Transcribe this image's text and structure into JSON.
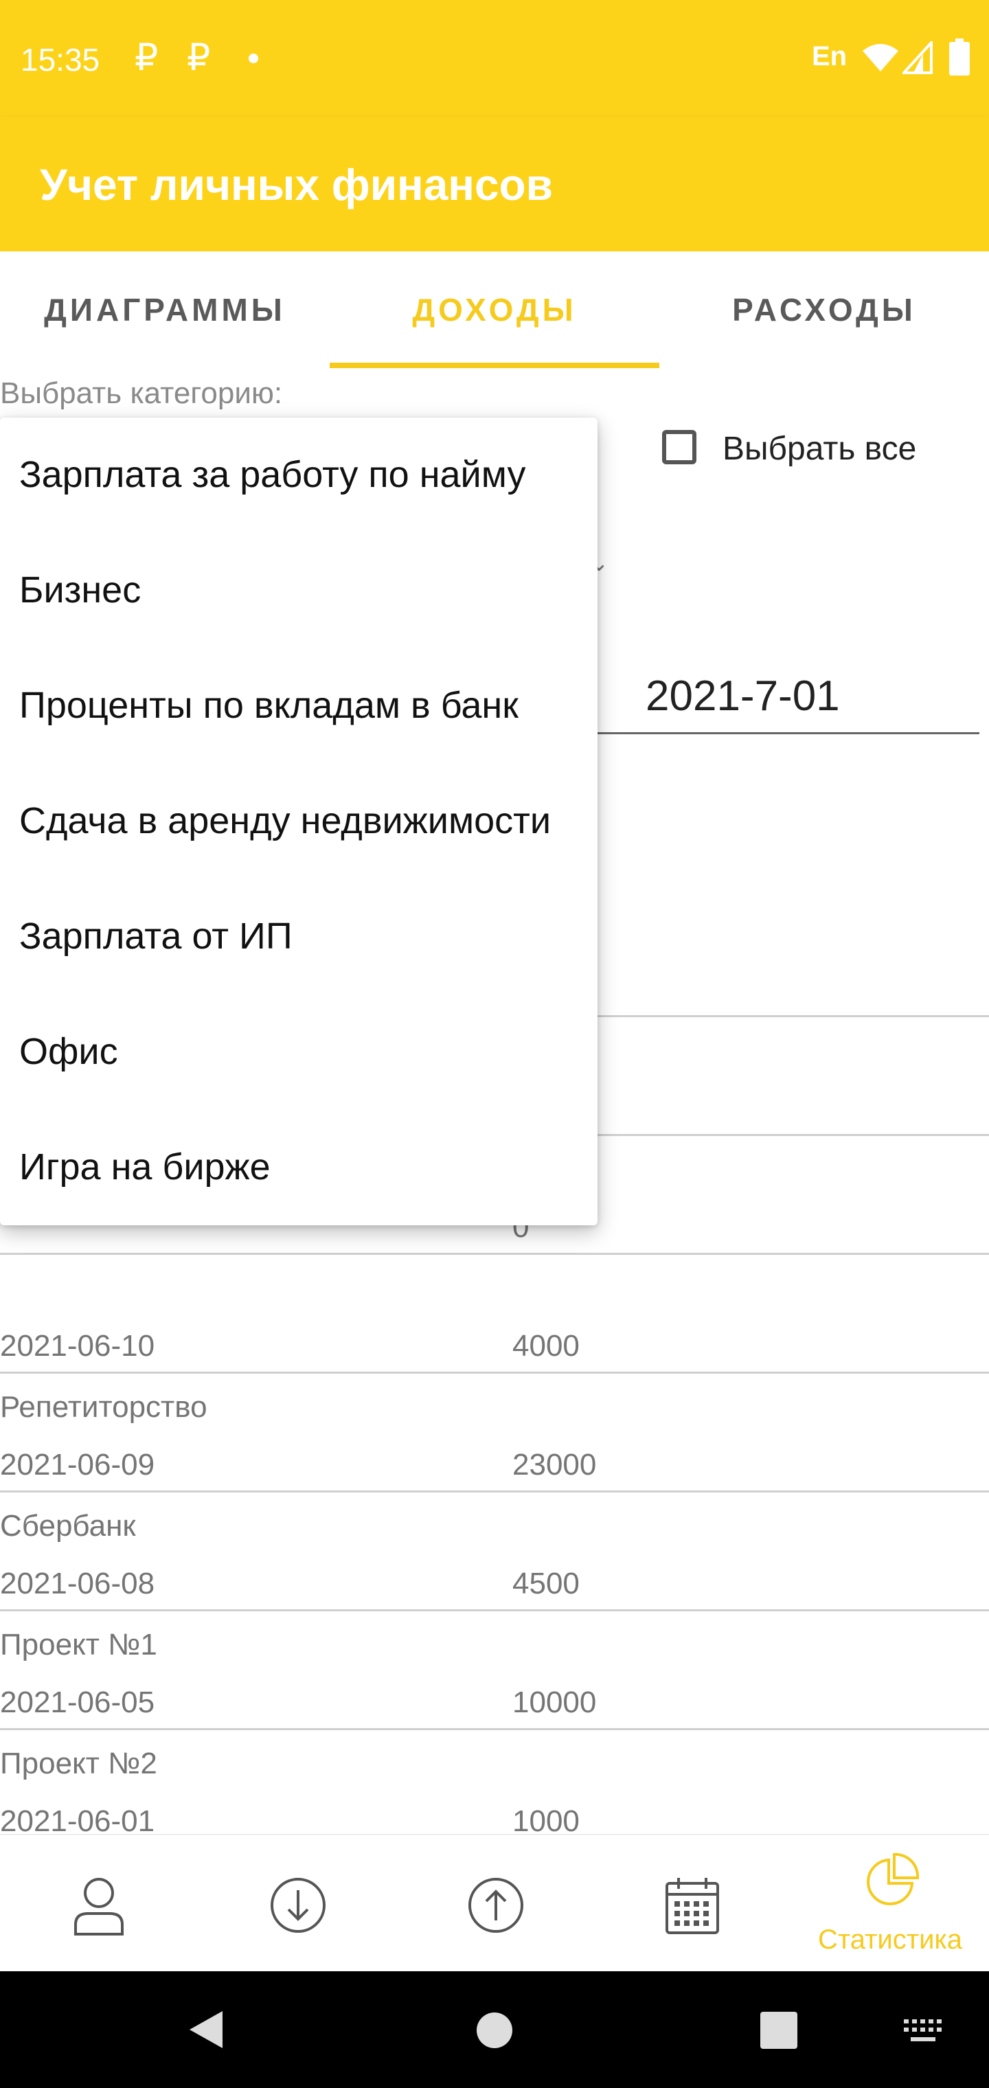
{
  "status_bar": {
    "time": "15:35",
    "currency_icon_1": "₽",
    "currency_icon_2": "₽",
    "language": "En"
  },
  "app_bar": {
    "title": "Учет личных финансов"
  },
  "tabs": [
    {
      "label": "ДИАГРАММЫ",
      "active": false
    },
    {
      "label": "ДОХОДЫ",
      "active": true
    },
    {
      "label": "РАСХОДЫ",
      "active": false
    }
  ],
  "filter": {
    "category_label": "Выбрать категорию:",
    "select_all_label": "Выбрать все",
    "select_all_checked": false,
    "date_value": "2021-7-01"
  },
  "dropdown": {
    "items": [
      "Зарплата за работу по найму",
      "Бизнес",
      "Проценты по вкладам в банк",
      "Сдача в аренду недвижимости",
      "Зарплата от ИП",
      "Офис",
      "Игра на бирже"
    ]
  },
  "records": [
    {
      "category": "",
      "date": "",
      "amount": ""
    },
    {
      "category": "",
      "date": "",
      "amount": "0"
    },
    {
      "category": "",
      "date": "2021-06-10",
      "amount": "4000"
    },
    {
      "category": "Репетиторство",
      "date": "2021-06-09",
      "amount": "23000"
    },
    {
      "category": "Сбербанк",
      "date": "2021-06-08",
      "amount": "4500"
    },
    {
      "category": "Проект №1",
      "date": "2021-06-05",
      "amount": "10000"
    },
    {
      "category": "Проект №2",
      "date": "2021-06-01",
      "amount": "1000"
    }
  ],
  "bottom_nav": {
    "items": [
      {
        "icon": "person-icon",
        "label": ""
      },
      {
        "icon": "arrow-down-circle-icon",
        "label": ""
      },
      {
        "icon": "arrow-up-circle-icon",
        "label": ""
      },
      {
        "icon": "calendar-icon",
        "label": ""
      },
      {
        "icon": "pie-chart-icon",
        "label": "Статистика",
        "active": true
      }
    ]
  },
  "colors": {
    "primary": "#FDD31A",
    "accent": "#F6CB1E",
    "text_secondary": "#757575"
  }
}
